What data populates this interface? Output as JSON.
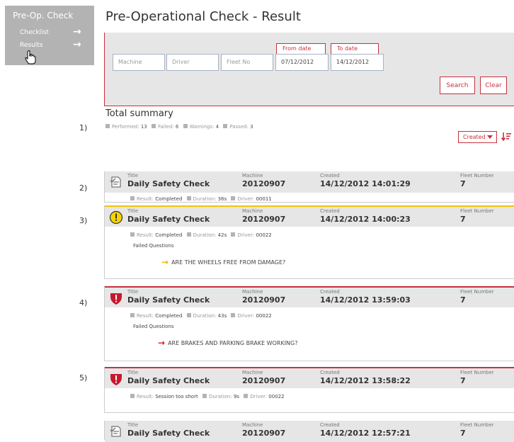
{
  "sidebar": {
    "title": "Pre-Op. Check",
    "items": [
      {
        "label": "Checklist",
        "arrow": "→"
      },
      {
        "label": "Results",
        "arrow": "→"
      }
    ]
  },
  "page_title": "Pre-Operational Check - Result",
  "filter": {
    "machine_placeholder": "Machine",
    "driver_placeholder": "Driver",
    "fleet_placeholder": "Fleet No",
    "from_label": "From date",
    "to_label": "To date",
    "from_value": "07/12/2012",
    "to_value": "14/12/2012",
    "search_label": "Search",
    "clear_label": "Clear"
  },
  "summary": {
    "title": "Total summary",
    "performed_label": "Performed:",
    "performed_value": "13",
    "failed_label": "Failed:",
    "failed_value": "6",
    "warnings_label": "Warnings:",
    "warnings_value": "4",
    "passed_label": "Passed:",
    "passed_value": "3"
  },
  "sort": {
    "selected": "Created"
  },
  "column_labels": {
    "title": "Title",
    "machine": "Machine",
    "created": "Created",
    "fleet": "Fleet Number"
  },
  "result_labels": {
    "result": "Result:",
    "duration": "Duration:",
    "driver": "Driver:",
    "failed_questions": "Failed Questions"
  },
  "row_numbers": [
    "1)",
    "2)",
    "3)",
    "4)",
    "5)"
  ],
  "results": [
    {
      "status": "ok",
      "icon": "checklist-doc-icon",
      "title": "Daily Safety Check",
      "machine": "20120907",
      "created": "14/12/2012 14:01:29",
      "fleet": "7",
      "result": "Completed",
      "duration": "36s",
      "driver": "00011"
    },
    {
      "status": "warning",
      "icon": "warning-icon",
      "title": "Daily Safety Check",
      "machine": "20120907",
      "created": "14/12/2012 14:00:23",
      "fleet": "7",
      "result": "Completed",
      "duration": "42s",
      "driver": "00022",
      "failed_question": "ARE THE WHEELS FREE FROM DAMAGE?"
    },
    {
      "status": "failed",
      "icon": "shield-alert-icon",
      "title": "Daily Safety Check",
      "machine": "20120907",
      "created": "14/12/2012 13:59:03",
      "fleet": "7",
      "result": "Completed",
      "duration": "43s",
      "driver": "00022",
      "failed_question": "ARE BRAKES AND PARKING BRAKE WORKING?"
    },
    {
      "status": "failed",
      "icon": "shield-alert-icon",
      "title": "Daily Safety Check",
      "machine": "20120907",
      "created": "14/12/2012 13:58:22",
      "fleet": "7",
      "result": "Session too short",
      "duration": "9s",
      "driver": "00022"
    },
    {
      "status": "ok",
      "icon": "checklist-doc-icon",
      "title": "Daily Safety Check",
      "machine": "20120907",
      "created": "14/12/2012 12:57:21",
      "fleet": "7"
    }
  ],
  "colors": {
    "accent": "#c9303e",
    "warning": "#f4c400",
    "sidebar_bg": "#b3b3b3",
    "panel_bg": "#e6e6e6"
  }
}
